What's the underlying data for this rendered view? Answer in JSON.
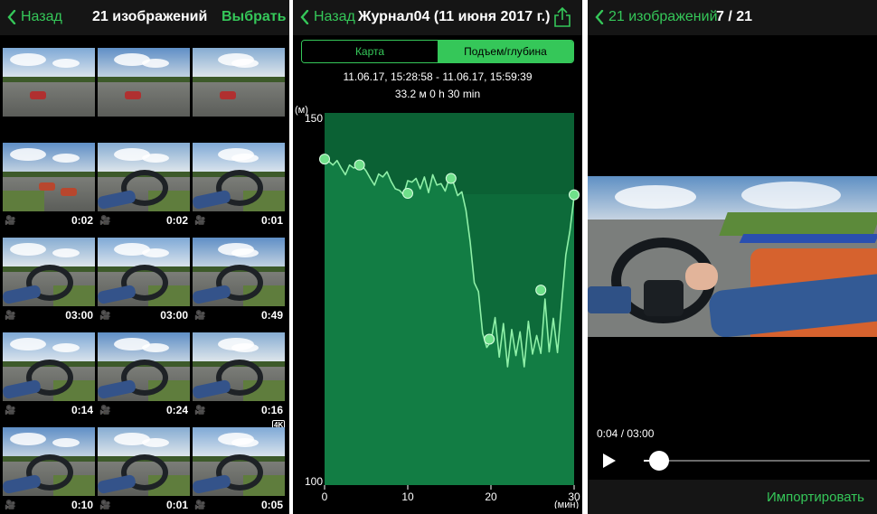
{
  "colors": {
    "accent": "#35c759",
    "chart_fill": "#0d6b3a",
    "chart_line": "#8ff0a8"
  },
  "screen1": {
    "back_label": "Назад",
    "title": "21 изображений",
    "select_label": "Выбрать",
    "rows": [
      {
        "cells": [
          {
            "type": "photo"
          },
          {
            "type": "photo"
          },
          {
            "type": "photo"
          }
        ]
      },
      {
        "cells": [
          {
            "type": "video",
            "duration": "0:02"
          },
          {
            "type": "video",
            "duration": "0:02"
          },
          {
            "type": "video",
            "duration": "0:01"
          }
        ]
      },
      {
        "cells": [
          {
            "type": "video",
            "duration": "03:00"
          },
          {
            "type": "video",
            "duration": "03:00"
          },
          {
            "type": "video",
            "duration": "0:49"
          }
        ]
      },
      {
        "cells": [
          {
            "type": "video",
            "duration": "0:14"
          },
          {
            "type": "video",
            "duration": "0:24"
          },
          {
            "type": "video",
            "duration": "0:16",
            "badge": "4K"
          }
        ]
      },
      {
        "cells": [
          {
            "type": "video",
            "duration": "0:10"
          },
          {
            "type": "video",
            "duration": "0:01"
          },
          {
            "type": "video",
            "duration": "0:05"
          }
        ]
      }
    ]
  },
  "screen2": {
    "back_label": "Назад",
    "title": "Журнал04 (11 июня 2017 г.)",
    "share_icon": "share-icon",
    "tabs": [
      {
        "label": "Карта",
        "active": false
      },
      {
        "label": "Подъем/глубина",
        "active": true
      }
    ],
    "time_range": "11.06.17, 15:28:58 - 11.06.17, 15:59:39",
    "summary": "33.2 м   0 h 30 min"
  },
  "chart_data": {
    "type": "area",
    "title": "",
    "xlabel": "(мин)",
    "ylabel": "(м)",
    "xlim": [
      0,
      30
    ],
    "ylim": [
      100,
      150
    ],
    "xticks": [
      0,
      10,
      20,
      30
    ],
    "yticks": [
      100,
      150
    ],
    "series": [
      {
        "values": [
          [
            0.0,
            143.8
          ],
          [
            0.5,
            143.5
          ],
          [
            1.0,
            143.0
          ],
          [
            1.5,
            143.6
          ],
          [
            2.0,
            142.6
          ],
          [
            2.5,
            141.7
          ],
          [
            3.0,
            143.0
          ],
          [
            3.5,
            142.6
          ],
          [
            4.0,
            142.8
          ],
          [
            4.5,
            142.9
          ],
          [
            5.0,
            142.2
          ],
          [
            5.5,
            141.2
          ],
          [
            6.0,
            140.3
          ],
          [
            6.5,
            141.8
          ],
          [
            7.0,
            141.4
          ],
          [
            7.5,
            142.1
          ],
          [
            8.0,
            140.8
          ],
          [
            8.5,
            139.8
          ],
          [
            9.0,
            139.6
          ],
          [
            9.5,
            139.0
          ],
          [
            10.0,
            140.9
          ],
          [
            10.5,
            140.7
          ],
          [
            11.0,
            141.2
          ],
          [
            11.5,
            139.8
          ],
          [
            12.0,
            141.4
          ],
          [
            12.5,
            139.3
          ],
          [
            13.0,
            141.7
          ],
          [
            13.5,
            140.3
          ],
          [
            14.0,
            140.5
          ],
          [
            14.5,
            139.5
          ],
          [
            15.0,
            141.3
          ],
          [
            15.5,
            140.6
          ],
          [
            16.0,
            138.9
          ],
          [
            16.5,
            139.4
          ],
          [
            17.0,
            136.9
          ],
          [
            17.5,
            132.7
          ],
          [
            18.0,
            127.2
          ],
          [
            18.5,
            126.0
          ],
          [
            19.0,
            120.4
          ],
          [
            19.5,
            118.5
          ],
          [
            20.0,
            119.3
          ],
          [
            20.5,
            122.5
          ],
          [
            21.0,
            117.2
          ],
          [
            21.5,
            121.7
          ],
          [
            22.0,
            115.9
          ],
          [
            22.5,
            120.9
          ],
          [
            23.0,
            117.4
          ],
          [
            23.5,
            120.6
          ],
          [
            24.0,
            115.9
          ],
          [
            24.5,
            122.0
          ],
          [
            25.0,
            117.6
          ],
          [
            25.5,
            120.1
          ],
          [
            26.0,
            117.7
          ],
          [
            26.5,
            125.0
          ],
          [
            27.0,
            117.9
          ],
          [
            27.5,
            122.4
          ],
          [
            28.0,
            117.8
          ],
          [
            28.5,
            124.4
          ],
          [
            29.0,
            130.9
          ],
          [
            29.5,
            134.2
          ],
          [
            30.0,
            138.8
          ]
        ]
      }
    ],
    "markers": [
      [
        0.0,
        143.8
      ],
      [
        4.2,
        143.0
      ],
      [
        10.0,
        139.2
      ],
      [
        15.2,
        141.2
      ],
      [
        19.8,
        119.6
      ],
      [
        26.0,
        126.2
      ],
      [
        30.0,
        139.0
      ]
    ],
    "grid": false
  },
  "screen3": {
    "back_label": "21 изображений",
    "counter": "7 / 21",
    "time_label": "0:04 / 03:00",
    "progress": 0.022,
    "import_label": "Импортировать"
  }
}
